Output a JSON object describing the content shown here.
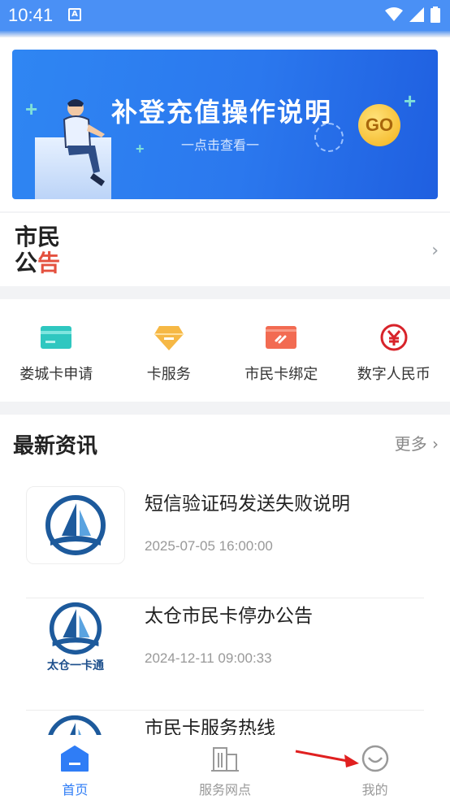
{
  "status_bar": {
    "time": "10:41",
    "notif_icon": "A"
  },
  "banner": {
    "title": "补登充值操作说明",
    "subtitle": "一点击查看一",
    "go_label": "GO"
  },
  "notice": {
    "label_line1": "市民",
    "label_line2_black": "公",
    "label_line2_red": "告"
  },
  "services": [
    {
      "label": "娄城卡申请",
      "icon": "card-icon",
      "color": "#2fc7c0"
    },
    {
      "label": "卡服务",
      "icon": "diamond-icon",
      "color": "#f6b845"
    },
    {
      "label": "市民卡绑定",
      "icon": "link-card-icon",
      "color": "#f26b52"
    },
    {
      "label": "数字人民币",
      "icon": "yuan-icon",
      "color": "#d8232a"
    }
  ],
  "news": {
    "title": "最新资讯",
    "more": "更多",
    "items": [
      {
        "title": "短信验证码发送失败说明",
        "date": "2025-07-05 16:00:00",
        "thumb_caption": ""
      },
      {
        "title": "太仓市民卡停办公告",
        "date": "2024-12-11 09:00:33",
        "thumb_caption": "太仓一卡通"
      },
      {
        "title": "市民卡服务热线",
        "date": "",
        "thumb_caption": ""
      }
    ]
  },
  "tabbar": [
    {
      "label": "首页",
      "icon": "home-icon",
      "active": true
    },
    {
      "label": "服务网点",
      "icon": "building-icon",
      "active": false
    },
    {
      "label": "我的",
      "icon": "smile-icon",
      "active": false
    }
  ],
  "colors": {
    "accent": "#2f7df6",
    "status_bar": "#4a90f5",
    "annotation_arrow": "#e02020"
  }
}
